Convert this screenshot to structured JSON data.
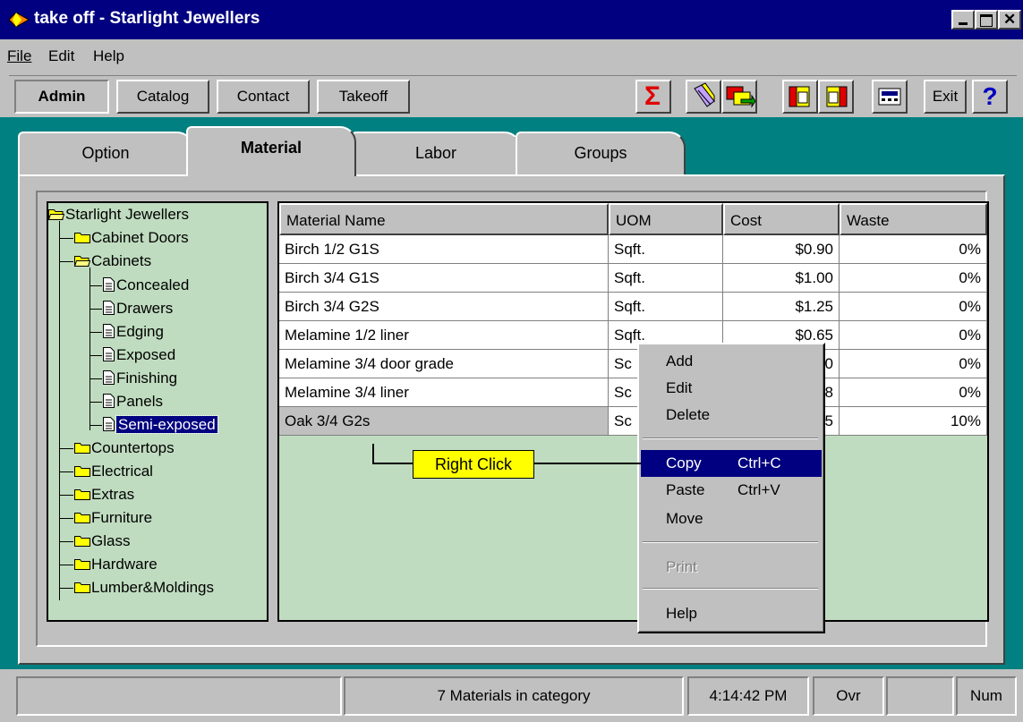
{
  "window": {
    "title": "take off - Starlight Jewellers"
  },
  "menu": [
    {
      "label": "File"
    },
    {
      "label": "Edit"
    },
    {
      "label": "Help"
    }
  ],
  "toolbar": {
    "tabs": [
      {
        "label": "Admin"
      },
      {
        "label": "Catalog"
      },
      {
        "label": "Contact"
      },
      {
        "label": "Takeoff"
      }
    ],
    "icons": [
      "sigma-icon",
      "pencil-eraser-icon",
      "swap-icon",
      "book-forward-icon",
      "book-back-icon",
      "calculator-icon"
    ],
    "exit_label": "Exit",
    "help_label": "?"
  },
  "tabs": [
    {
      "label": "Option"
    },
    {
      "label": "Material"
    },
    {
      "label": "Labor"
    },
    {
      "label": "Groups"
    }
  ],
  "active_tab": "Material",
  "tree": {
    "root": "Starlight Jewellers",
    "nodes": [
      {
        "label": "Cabinet Doors"
      },
      {
        "label": "Cabinets"
      },
      {
        "label": "Concealed"
      },
      {
        "label": "Drawers"
      },
      {
        "label": "Edging"
      },
      {
        "label": "Exposed"
      },
      {
        "label": "Finishing"
      },
      {
        "label": "Panels"
      },
      {
        "label": "Semi-exposed"
      },
      {
        "label": "Countertops"
      },
      {
        "label": "Electrical"
      },
      {
        "label": "Extras"
      },
      {
        "label": "Furniture"
      },
      {
        "label": "Glass"
      },
      {
        "label": "Hardware"
      },
      {
        "label": "Lumber&Moldings"
      }
    ],
    "selected": "Semi-exposed"
  },
  "grid": {
    "columns": [
      "Material Name",
      "UOM",
      "Cost",
      "Waste"
    ],
    "rows": [
      [
        "Birch 1/2 G1S",
        "Sqft.",
        "$0.90",
        "0%"
      ],
      [
        "Birch 3/4 G1S",
        "Sqft.",
        "$1.00",
        "0%"
      ],
      [
        "Birch 3/4 G2S",
        "Sqft.",
        "$1.25",
        "0%"
      ],
      [
        "Melamine 1/2 liner",
        "Sqft.",
        "$0.65",
        "0%"
      ],
      [
        "Melamine 3/4 door grade",
        "Sc",
        "0",
        "0%"
      ],
      [
        "Melamine 3/4 liner",
        "Sc",
        "8",
        "0%"
      ],
      [
        "Oak 3/4 G2s",
        "Sc",
        "5",
        "10%"
      ]
    ]
  },
  "context_menu": {
    "items": [
      {
        "label": "Add",
        "shortcut": ""
      },
      {
        "label": "Edit",
        "shortcut": ""
      },
      {
        "label": "Delete",
        "shortcut": ""
      },
      {
        "label": "Copy",
        "shortcut": "Ctrl+C"
      },
      {
        "label": "Paste",
        "shortcut": "Ctrl+V"
      },
      {
        "label": "Move",
        "shortcut": ""
      },
      {
        "label": "Print",
        "shortcut": ""
      },
      {
        "label": "Help",
        "shortcut": ""
      }
    ],
    "highlighted": "Copy",
    "disabled": "Print"
  },
  "callout": {
    "label": "Right Click"
  },
  "status": {
    "message": "7 Materials in category",
    "time": "4:14:42 PM",
    "mode": "Ovr",
    "num": "Num"
  }
}
